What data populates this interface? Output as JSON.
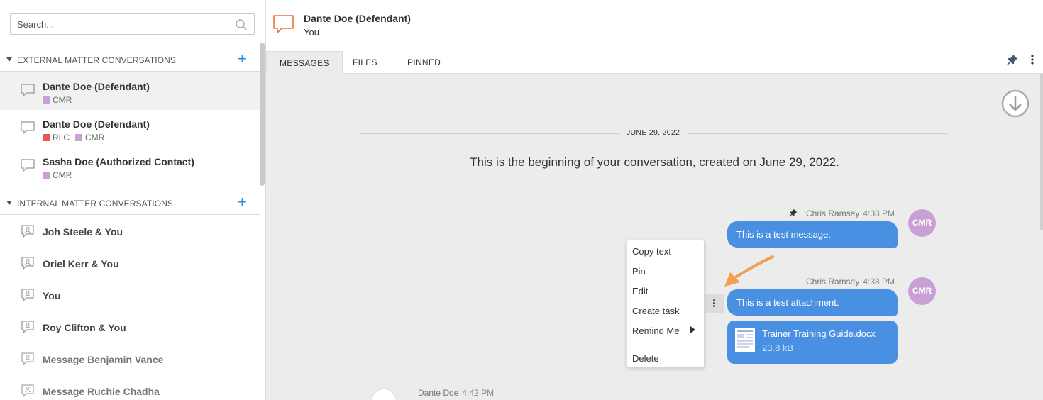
{
  "sidebar": {
    "search_placeholder": "Search...",
    "external_section": {
      "title": "EXTERNAL MATTER CONVERSATIONS",
      "add": "+",
      "items": [
        {
          "name": "Dante Doe (Defendant)",
          "tags": [
            {
              "label": "CMR",
              "color": "#c99fd6"
            }
          ]
        },
        {
          "name": "Dante Doe (Defendant)",
          "tags": [
            {
              "label": "RLC",
              "color": "#e05a5a"
            },
            {
              "label": "CMR",
              "color": "#c99fd6"
            }
          ]
        },
        {
          "name": "Sasha Doe (Authorized Contact)",
          "tags": [
            {
              "label": "CMR",
              "color": "#c99fd6"
            }
          ]
        }
      ]
    },
    "internal_section": {
      "title": "INTERNAL MATTER CONVERSATIONS",
      "add": "+",
      "items": [
        {
          "name": "Joh Steele & You"
        },
        {
          "name": "Oriel Kerr & You"
        },
        {
          "name": "You"
        },
        {
          "name": "Roy Clifton & You"
        },
        {
          "name": "Message Benjamin Vance"
        },
        {
          "name": "Message Ruchie Chadha"
        }
      ]
    }
  },
  "header": {
    "title": "Dante Doe (Defendant)",
    "subtitle": "You"
  },
  "tabs": [
    "MESSAGES",
    "FILES",
    "PINNED"
  ],
  "conversation": {
    "date_label": "JUNE 29, 2022",
    "beginning_text": "This is the beginning of your conversation, created on June 29, 2022.",
    "messages": [
      {
        "author": "Chris Ramsey",
        "time": "4:38 PM",
        "text": "This is a test message.",
        "avatar": "CMR",
        "pinned": true
      },
      {
        "author": "Chris Ramsey",
        "time": "4:38 PM",
        "text": "This is a test attachment.",
        "avatar": "CMR",
        "attachment": {
          "name": "Trainer Training Guide.docx",
          "size": "23.8 kB"
        }
      },
      {
        "author": "Dante Doe",
        "time": "4:42 PM"
      }
    ]
  },
  "context_menu": {
    "items": [
      "Copy text",
      "Pin",
      "Edit",
      "Create task",
      "Remind Me",
      "Delete"
    ]
  },
  "colors": {
    "accent": "#2d8ae0",
    "bubble": "#4a90e2",
    "avatar": "#c99fd6",
    "arrow": "#f0a050"
  }
}
